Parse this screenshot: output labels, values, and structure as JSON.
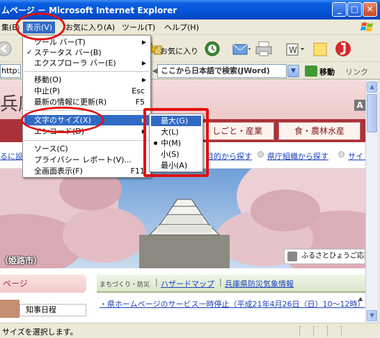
{
  "window": {
    "title": "ムページ － Microsoft Internet Explorer",
    "min_glyph": "_",
    "max_glyph": "□",
    "close_glyph": "✕"
  },
  "menubar": {
    "items": [
      {
        "label": "集(E)"
      },
      {
        "label": "表示(V)"
      },
      {
        "label": "お気に入り(A)"
      },
      {
        "label": "ツール(T)"
      },
      {
        "label": "ヘルプ(H)"
      }
    ]
  },
  "toolbar": {
    "favorites_label": "お気に入り"
  },
  "addressbar": {
    "value": "http://w",
    "jword_text": "ここから日本語で検索(JWord)",
    "go_label": "移動",
    "links_label": "リンク"
  },
  "view_menu": {
    "items": [
      {
        "label": "ツール バー(T)",
        "shortcut": "",
        "check": "",
        "submenu": true
      },
      {
        "label": "ステータス バー(B)",
        "shortcut": "",
        "check": "✓",
        "submenu": false
      },
      {
        "label": "エクスプローラ バー(E)",
        "shortcut": "",
        "check": "",
        "submenu": true
      },
      {
        "label": "移動(O)",
        "shortcut": "",
        "check": "",
        "submenu": true
      },
      {
        "label": "中止(P)",
        "shortcut": "Esc",
        "check": "",
        "submenu": false
      },
      {
        "label": "最新の情報に更新(R)",
        "shortcut": "F5",
        "check": "",
        "submenu": false
      },
      {
        "label": "文字のサイズ(X)",
        "shortcut": "",
        "check": "",
        "submenu": true
      },
      {
        "label": "エンコード(D)",
        "shortcut": "",
        "check": "",
        "submenu": true
      },
      {
        "label": "ソース(C)",
        "shortcut": "",
        "check": "",
        "submenu": false
      },
      {
        "label": "プライバシー レポート(V)...",
        "shortcut": "",
        "check": "",
        "submenu": false
      },
      {
        "label": "全画面表示(F)",
        "shortcut": "F11",
        "check": "",
        "submenu": false
      }
    ]
  },
  "text_size_menu": {
    "items": [
      {
        "label": "最大(G)",
        "selected": false
      },
      {
        "label": "大(L)",
        "selected": false
      },
      {
        "label": "中(M)",
        "selected": true
      },
      {
        "label": "小(S)",
        "selected": false
      },
      {
        "label": "最小(A)",
        "selected": false
      }
    ]
  },
  "page": {
    "site_title": "兵庫",
    "a_badge": "A",
    "nav_tabs": [
      "しごと・産業",
      "食・農林水産"
    ],
    "subnav_links": [
      "目的から探す",
      "県庁組織から探す",
      "サイト"
    ],
    "subnav_left_fragment": "るに設",
    "photo_caption": "（姫路市）",
    "furusato_text": "ふるさとひょうご応援",
    "left_pill": "ページ",
    "chiji_link": "知事日程",
    "news_tab_label": "まちづくり・防災",
    "news_links": [
      "ハザードマップ",
      "兵庫県防災気象情報"
    ],
    "news_item": "・県ホームページのサービス一時停止（平成21年4月26日（日）10〜12時）"
  },
  "status": {
    "text": "サイズを選択します。"
  },
  "colors": {
    "title_blue": "#0454d8",
    "menu_highlight": "#316ac5",
    "annotation_red": "#e01010",
    "nav_red": "#a93238"
  }
}
